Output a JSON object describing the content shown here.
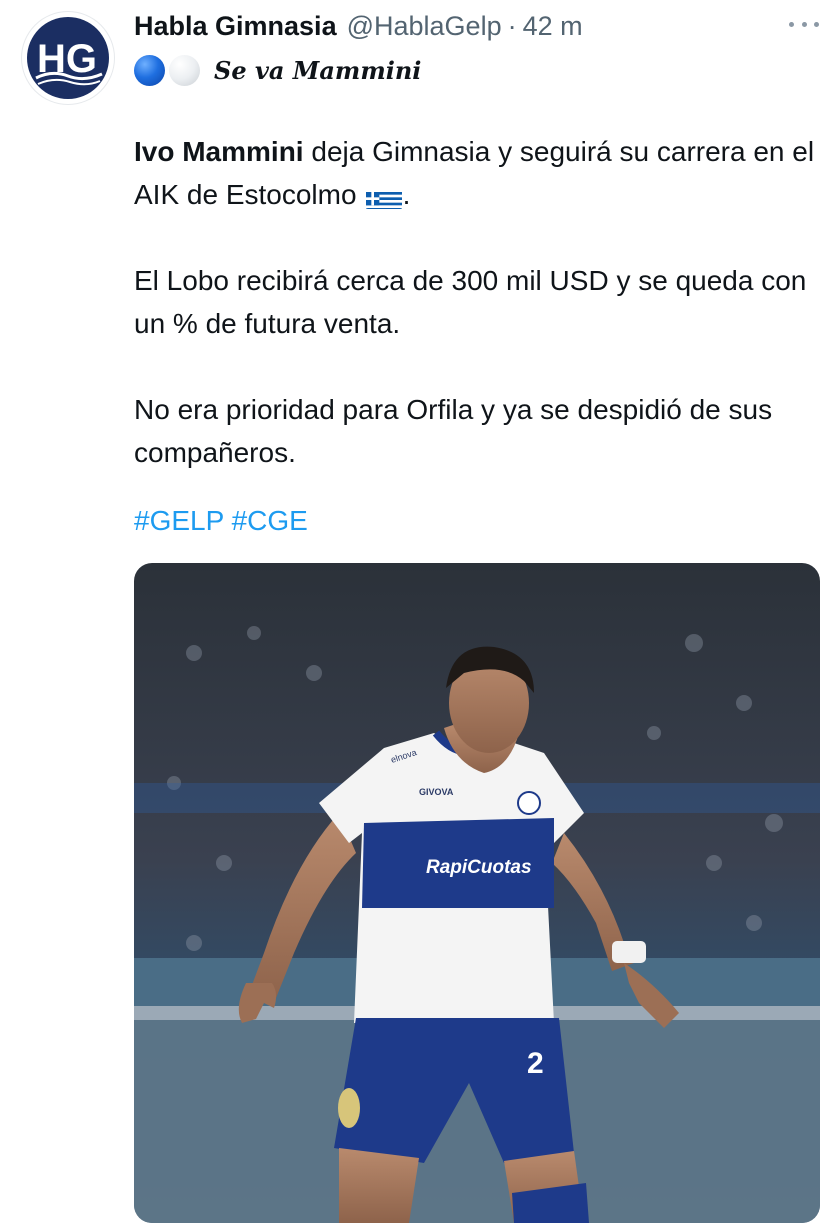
{
  "tweet": {
    "display_name": "Habla Gimnasia",
    "handle": "@HablaGelp",
    "separator": "·",
    "time": "42 m",
    "subtitle": "Se va Mammini",
    "para1_bold": "Ivo Mammini",
    "para1_rest": " deja Gimnasia y seguirá su carrera en el AIK de Estocolmo",
    "para1_end": ".",
    "para2": "El Lobo recibirá cerca de 300 mil USD y se queda con un % de futura venta.",
    "para3": "No era prioridad para Orfila y ya se despidió de sus compañeros.",
    "hashtags": [
      "#GELP",
      "#CGE"
    ]
  },
  "avatar": {
    "logo_text": "HG",
    "colors": {
      "navy": "#1b2e62",
      "white": "#ffffff"
    }
  },
  "photo": {
    "shirt_sponsor": "RapiCuotas",
    "shirt_brand": "GIVOVA",
    "sleeve_text": "elnova",
    "shorts_number": "2"
  },
  "colors": {
    "link": "#1d9bf0",
    "text": "#0f1419",
    "muted": "#536471"
  },
  "icons": {
    "more": "more-horizontal-icon",
    "flag": "greece-flag-icon"
  }
}
